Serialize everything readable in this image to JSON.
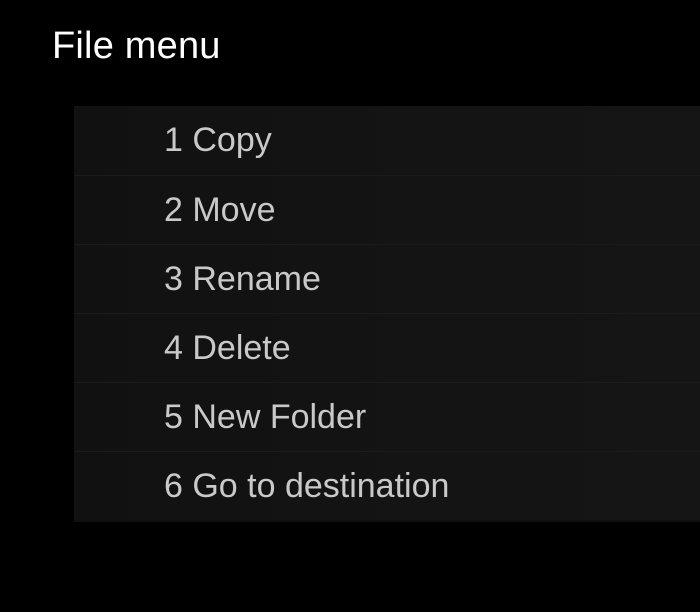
{
  "menu": {
    "title": "File menu",
    "items": [
      {
        "label": "1 Copy"
      },
      {
        "label": "2 Move"
      },
      {
        "label": "3 Rename"
      },
      {
        "label": "4 Delete"
      },
      {
        "label": "5 New Folder"
      },
      {
        "label": "6 Go to destination"
      }
    ]
  },
  "colors": {
    "background": "#000000",
    "title_text": "#ffffff",
    "item_text": "#c9c9c9",
    "panel": "#0f0f0f"
  }
}
